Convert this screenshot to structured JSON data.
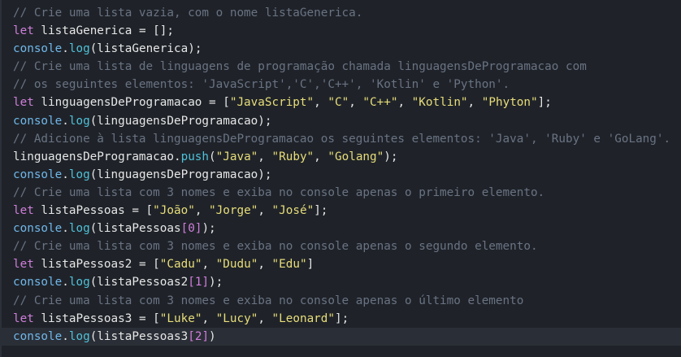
{
  "editor": {
    "lines": [
      [
        {
          "t": "comment",
          "v": "// Crie uma lista vazia, com o nome listaGenerica."
        }
      ],
      [
        {
          "t": "keyword",
          "v": "let"
        },
        {
          "t": "ident",
          "v": " listaGenerica "
        },
        {
          "t": "punct",
          "v": "= [];"
        }
      ],
      [
        {
          "t": "console",
          "v": "console"
        },
        {
          "t": "punct",
          "v": "."
        },
        {
          "t": "method",
          "v": "log"
        },
        {
          "t": "punct",
          "v": "(listaGenerica);"
        }
      ],
      [
        {
          "t": "comment",
          "v": "// Crie uma lista de linguagens de programação chamada linguagensDeProgramacao com"
        }
      ],
      [
        {
          "t": "comment",
          "v": "// os seguintes elementos: 'JavaScript','C','C++', 'Kotlin' e 'Python'."
        }
      ],
      [
        {
          "t": "keyword",
          "v": "let"
        },
        {
          "t": "ident",
          "v": " linguagensDeProgramacao "
        },
        {
          "t": "punct",
          "v": "= ["
        },
        {
          "t": "string",
          "v": "\"JavaScript\""
        },
        {
          "t": "punct",
          "v": ", "
        },
        {
          "t": "string",
          "v": "\"C\""
        },
        {
          "t": "punct",
          "v": ", "
        },
        {
          "t": "string",
          "v": "\"C++\""
        },
        {
          "t": "punct",
          "v": ", "
        },
        {
          "t": "string",
          "v": "\"Kotlin\""
        },
        {
          "t": "punct",
          "v": ", "
        },
        {
          "t": "string",
          "v": "\"Phyton\""
        },
        {
          "t": "punct",
          "v": "];"
        }
      ],
      [
        {
          "t": "console",
          "v": "console"
        },
        {
          "t": "punct",
          "v": "."
        },
        {
          "t": "method",
          "v": "log"
        },
        {
          "t": "punct",
          "v": "(linguagensDeProgramacao);"
        }
      ],
      [
        {
          "t": "comment",
          "v": "// Adicione à lista linguagensDeProgramacao os seguintes elementos: 'Java', 'Ruby' e 'GoLang'."
        }
      ],
      [
        {
          "t": "ident",
          "v": "linguagensDeProgramacao"
        },
        {
          "t": "punct",
          "v": "."
        },
        {
          "t": "method",
          "v": "push"
        },
        {
          "t": "punct",
          "v": "("
        },
        {
          "t": "string",
          "v": "\"Java\""
        },
        {
          "t": "punct",
          "v": ", "
        },
        {
          "t": "string",
          "v": "\"Ruby\""
        },
        {
          "t": "punct",
          "v": ", "
        },
        {
          "t": "string",
          "v": "\"Golang\""
        },
        {
          "t": "punct",
          "v": ");"
        }
      ],
      [
        {
          "t": "console",
          "v": "console"
        },
        {
          "t": "punct",
          "v": "."
        },
        {
          "t": "method",
          "v": "log"
        },
        {
          "t": "punct",
          "v": "(linguagensDeProgramacao);"
        }
      ],
      [
        {
          "t": "comment",
          "v": "// Crie uma lista com 3 nomes e exiba no console apenas o primeiro elemento."
        }
      ],
      [
        {
          "t": "keyword",
          "v": "let"
        },
        {
          "t": "ident",
          "v": " listaPessoas "
        },
        {
          "t": "punct",
          "v": "= ["
        },
        {
          "t": "string",
          "v": "\"João\""
        },
        {
          "t": "punct",
          "v": ", "
        },
        {
          "t": "string",
          "v": "\"Jorge\""
        },
        {
          "t": "punct",
          "v": ", "
        },
        {
          "t": "string",
          "v": "\"José\""
        },
        {
          "t": "punct",
          "v": "];"
        }
      ],
      [
        {
          "t": "console",
          "v": "console"
        },
        {
          "t": "punct",
          "v": "."
        },
        {
          "t": "method",
          "v": "log"
        },
        {
          "t": "punct",
          "v": "(listaPessoas"
        },
        {
          "t": "bracket",
          "v": "["
        },
        {
          "t": "number",
          "v": "0"
        },
        {
          "t": "bracket",
          "v": "]"
        },
        {
          "t": "punct",
          "v": ");"
        }
      ],
      [
        {
          "t": "comment",
          "v": "// Crie uma lista com 3 nomes e exiba no console apenas o segundo elemento."
        }
      ],
      [
        {
          "t": "keyword",
          "v": "let"
        },
        {
          "t": "ident",
          "v": " listaPessoas2 "
        },
        {
          "t": "punct",
          "v": "= ["
        },
        {
          "t": "string",
          "v": "\"Cadu\""
        },
        {
          "t": "punct",
          "v": ", "
        },
        {
          "t": "string",
          "v": "\"Dudu\""
        },
        {
          "t": "punct",
          "v": ", "
        },
        {
          "t": "string",
          "v": "\"Edu\""
        },
        {
          "t": "punct",
          "v": "]"
        }
      ],
      [
        {
          "t": "console",
          "v": "console"
        },
        {
          "t": "punct",
          "v": "."
        },
        {
          "t": "method",
          "v": "log"
        },
        {
          "t": "punct",
          "v": "(listaPessoas2"
        },
        {
          "t": "bracket",
          "v": "["
        },
        {
          "t": "number",
          "v": "1"
        },
        {
          "t": "bracket",
          "v": "]"
        },
        {
          "t": "punct",
          "v": ");"
        }
      ],
      [
        {
          "t": "comment",
          "v": "// Crie uma lista com 3 nomes e exiba no console apenas o último elemento"
        }
      ],
      [
        {
          "t": "keyword",
          "v": "let"
        },
        {
          "t": "ident",
          "v": " listaPessoas3 "
        },
        {
          "t": "punct",
          "v": "= ["
        },
        {
          "t": "string",
          "v": "\"Luke\""
        },
        {
          "t": "punct",
          "v": ", "
        },
        {
          "t": "string",
          "v": "\"Lucy\""
        },
        {
          "t": "punct",
          "v": ", "
        },
        {
          "t": "string",
          "v": "\"Leonard\""
        },
        {
          "t": "punct",
          "v": "];"
        }
      ],
      [
        {
          "t": "console",
          "v": "console"
        },
        {
          "t": "punct",
          "v": "."
        },
        {
          "t": "method",
          "v": "log"
        },
        {
          "t": "punct",
          "v": "("
        },
        {
          "t": "ident",
          "v": "listaPessoas3"
        },
        {
          "t": "bracket",
          "v": "["
        },
        {
          "t": "number",
          "v": "2"
        },
        {
          "t": "bracket",
          "v": "]"
        },
        {
          "t": "punct",
          "v": ")"
        }
      ]
    ],
    "current_line_index": 18
  },
  "colors": {
    "background": "#1f2329",
    "comment": "#6a7383",
    "keyword": "#d07edb",
    "string": "#e8dd7a",
    "method": "#4fc1d9",
    "console": "#70b7ea",
    "text": "#e6e6e6"
  }
}
